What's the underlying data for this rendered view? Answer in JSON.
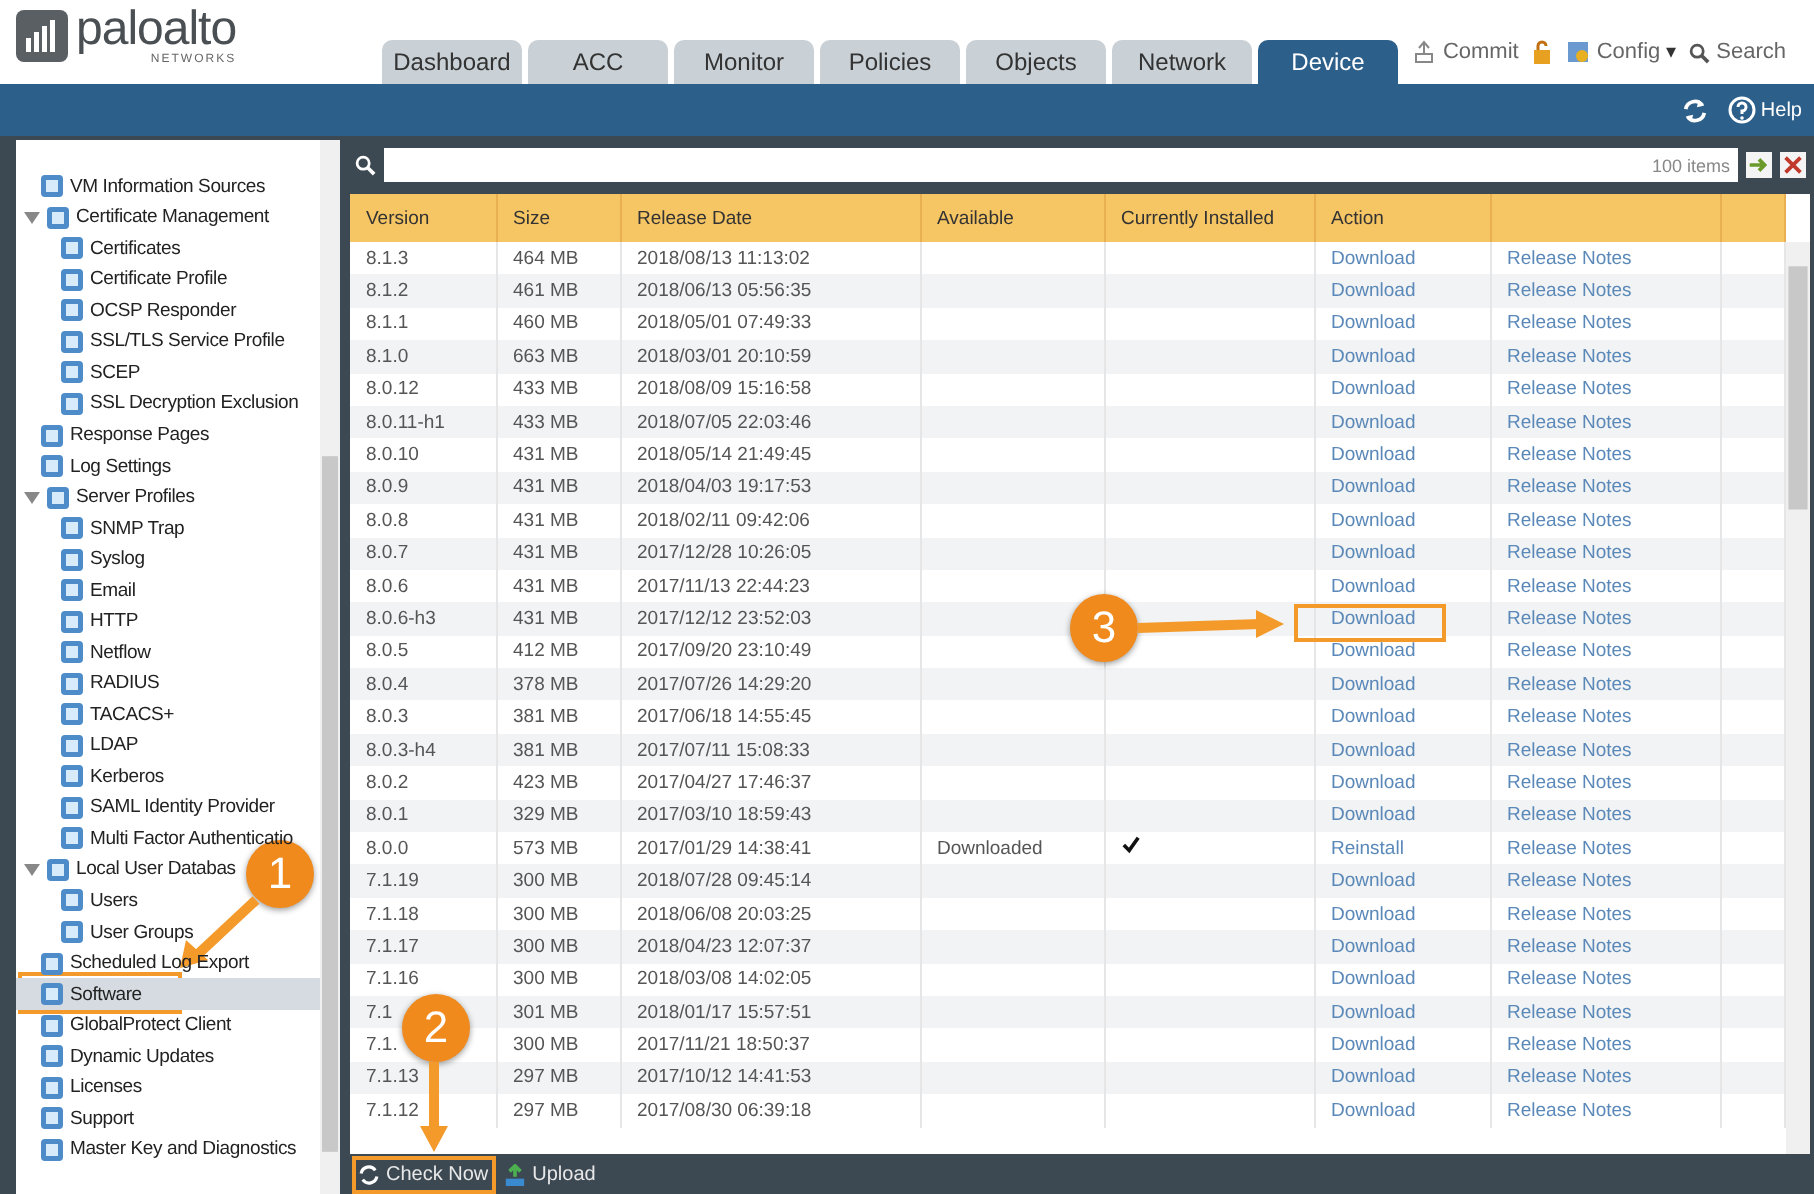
{
  "logo": {
    "name": "paloalto",
    "tagline": "NETWORKS"
  },
  "tabs": [
    {
      "label": "Dashboard",
      "selected": false
    },
    {
      "label": "ACC",
      "selected": false
    },
    {
      "label": "Monitor",
      "selected": false
    },
    {
      "label": "Policies",
      "selected": false
    },
    {
      "label": "Objects",
      "selected": false
    },
    {
      "label": "Network",
      "selected": false
    },
    {
      "label": "Device",
      "selected": true
    }
  ],
  "header_actions": {
    "commit": "Commit",
    "config": "Config",
    "config_caret": "▾",
    "search": "Search"
  },
  "toolbar": {
    "help": "Help"
  },
  "sidebar": {
    "items": [
      {
        "label": "VM Information Sources",
        "selected": false
      },
      {
        "label": "Certificate Management",
        "selected": false,
        "expanded": true,
        "children": [
          {
            "label": "Certificates",
            "selected": false
          },
          {
            "label": "Certificate Profile",
            "selected": false
          },
          {
            "label": "OCSP Responder",
            "selected": false
          },
          {
            "label": "SSL/TLS Service Profile",
            "selected": false
          },
          {
            "label": "SCEP",
            "selected": false
          },
          {
            "label": "SSL Decryption Exclusion",
            "selected": false
          }
        ]
      },
      {
        "label": "Response Pages",
        "selected": false
      },
      {
        "label": "Log Settings",
        "selected": false
      },
      {
        "label": "Server Profiles",
        "selected": false,
        "expanded": true,
        "children": [
          {
            "label": "SNMP Trap",
            "selected": false
          },
          {
            "label": "Syslog",
            "selected": false
          },
          {
            "label": "Email",
            "selected": false
          },
          {
            "label": "HTTP",
            "selected": false
          },
          {
            "label": "Netflow",
            "selected": false
          },
          {
            "label": "RADIUS",
            "selected": false
          },
          {
            "label": "TACACS+",
            "selected": false
          },
          {
            "label": "LDAP",
            "selected": false
          },
          {
            "label": "Kerberos",
            "selected": false
          },
          {
            "label": "SAML Identity Provider",
            "selected": false
          },
          {
            "label": "Multi Factor Authenticatio",
            "selected": false
          }
        ]
      },
      {
        "label": "Local User Databas",
        "selected": false,
        "expanded": true,
        "children": [
          {
            "label": "Users",
            "selected": false
          },
          {
            "label": "User Groups",
            "selected": false
          }
        ]
      },
      {
        "label": "Scheduled Log Export",
        "selected": false
      },
      {
        "label": "Software",
        "selected": true
      },
      {
        "label": "GlobalProtect Client",
        "selected": false
      },
      {
        "label": "Dynamic Updates",
        "selected": false
      },
      {
        "label": "Licenses",
        "selected": false
      },
      {
        "label": "Support",
        "selected": false
      },
      {
        "label": "Master Key and Diagnostics",
        "selected": false
      }
    ]
  },
  "filter": {
    "count": "100 items"
  },
  "table": {
    "columns": [
      "Version",
      "Size",
      "Release Date",
      "Available",
      "Currently Installed",
      "Action"
    ],
    "rows": [
      {
        "version": "8.1.3",
        "size": "464 MB",
        "date": "2018/08/13 11:13:02",
        "available": "",
        "installed": false,
        "action": "Download",
        "notes": "Release Notes"
      },
      {
        "version": "8.1.2",
        "size": "461 MB",
        "date": "2018/06/13 05:56:35",
        "available": "",
        "installed": false,
        "action": "Download",
        "notes": "Release Notes"
      },
      {
        "version": "8.1.1",
        "size": "460 MB",
        "date": "2018/05/01 07:49:33",
        "available": "",
        "installed": false,
        "action": "Download",
        "notes": "Release Notes"
      },
      {
        "version": "8.1.0",
        "size": "663 MB",
        "date": "2018/03/01 20:10:59",
        "available": "",
        "installed": false,
        "action": "Download",
        "notes": "Release Notes"
      },
      {
        "version": "8.0.12",
        "size": "433 MB",
        "date": "2018/08/09 15:16:58",
        "available": "",
        "installed": false,
        "action": "Download",
        "notes": "Release Notes"
      },
      {
        "version": "8.0.11-h1",
        "size": "433 MB",
        "date": "2018/07/05 22:03:46",
        "available": "",
        "installed": false,
        "action": "Download",
        "notes": "Release Notes"
      },
      {
        "version": "8.0.10",
        "size": "431 MB",
        "date": "2018/05/14 21:49:45",
        "available": "",
        "installed": false,
        "action": "Download",
        "notes": "Release Notes"
      },
      {
        "version": "8.0.9",
        "size": "431 MB",
        "date": "2018/04/03 19:17:53",
        "available": "",
        "installed": false,
        "action": "Download",
        "notes": "Release Notes"
      },
      {
        "version": "8.0.8",
        "size": "431 MB",
        "date": "2018/02/11 09:42:06",
        "available": "",
        "installed": false,
        "action": "Download",
        "notes": "Release Notes"
      },
      {
        "version": "8.0.7",
        "size": "431 MB",
        "date": "2017/12/28 10:26:05",
        "available": "",
        "installed": false,
        "action": "Download",
        "notes": "Release Notes"
      },
      {
        "version": "8.0.6",
        "size": "431 MB",
        "date": "2017/11/13 22:44:23",
        "available": "",
        "installed": false,
        "action": "Download",
        "notes": "Release Notes"
      },
      {
        "version": "8.0.6-h3",
        "size": "431 MB",
        "date": "2017/12/12 23:52:03",
        "available": "",
        "installed": false,
        "action": "Download",
        "notes": "Release Notes"
      },
      {
        "version": "8.0.5",
        "size": "412 MB",
        "date": "2017/09/20 23:10:49",
        "available": "",
        "installed": false,
        "action": "Download",
        "notes": "Release Notes"
      },
      {
        "version": "8.0.4",
        "size": "378 MB",
        "date": "2017/07/26 14:29:20",
        "available": "",
        "installed": false,
        "action": "Download",
        "notes": "Release Notes"
      },
      {
        "version": "8.0.3",
        "size": "381 MB",
        "date": "2017/06/18 14:55:45",
        "available": "",
        "installed": false,
        "action": "Download",
        "notes": "Release Notes"
      },
      {
        "version": "8.0.3-h4",
        "size": "381 MB",
        "date": "2017/07/11 15:08:33",
        "available": "",
        "installed": false,
        "action": "Download",
        "notes": "Release Notes"
      },
      {
        "version": "8.0.2",
        "size": "423 MB",
        "date": "2017/04/27 17:46:37",
        "available": "",
        "installed": false,
        "action": "Download",
        "notes": "Release Notes"
      },
      {
        "version": "8.0.1",
        "size": "329 MB",
        "date": "2017/03/10 18:59:43",
        "available": "",
        "installed": false,
        "action": "Download",
        "notes": "Release Notes"
      },
      {
        "version": "8.0.0",
        "size": "573 MB",
        "date": "2017/01/29 14:38:41",
        "available": "Downloaded",
        "installed": true,
        "action": "Reinstall",
        "notes": "Release Notes"
      },
      {
        "version": "7.1.19",
        "size": "300 MB",
        "date": "2018/07/28 09:45:14",
        "available": "",
        "installed": false,
        "action": "Download",
        "notes": "Release Notes"
      },
      {
        "version": "7.1.18",
        "size": "300 MB",
        "date": "2018/06/08 20:03:25",
        "available": "",
        "installed": false,
        "action": "Download",
        "notes": "Release Notes"
      },
      {
        "version": "7.1.17",
        "size": "300 MB",
        "date": "2018/04/23 12:07:37",
        "available": "",
        "installed": false,
        "action": "Download",
        "notes": "Release Notes"
      },
      {
        "version": "7.1.16",
        "size": "300 MB",
        "date": "2018/03/08 14:02:05",
        "available": "",
        "installed": false,
        "action": "Download",
        "notes": "Release Notes"
      },
      {
        "version": "7.1",
        "size": "301 MB",
        "date": "2018/01/17 15:57:51",
        "available": "",
        "installed": false,
        "action": "Download",
        "notes": "Release Notes"
      },
      {
        "version": "7.1.",
        "size": "300 MB",
        "date": "2017/11/21 18:50:37",
        "available": "",
        "installed": false,
        "action": "Download",
        "notes": "Release Notes"
      },
      {
        "version": "7.1.13",
        "size": "297 MB",
        "date": "2017/10/12 14:41:53",
        "available": "",
        "installed": false,
        "action": "Download",
        "notes": "Release Notes"
      },
      {
        "version": "7.1.12",
        "size": "297 MB",
        "date": "2017/08/30 06:39:18",
        "available": "",
        "installed": false,
        "action": "Download",
        "notes": "Release Notes"
      }
    ]
  },
  "footer": {
    "check_now": "Check Now",
    "upload": "Upload"
  },
  "annotations": [
    {
      "number": "1"
    },
    {
      "number": "2"
    },
    {
      "number": "3"
    }
  ]
}
